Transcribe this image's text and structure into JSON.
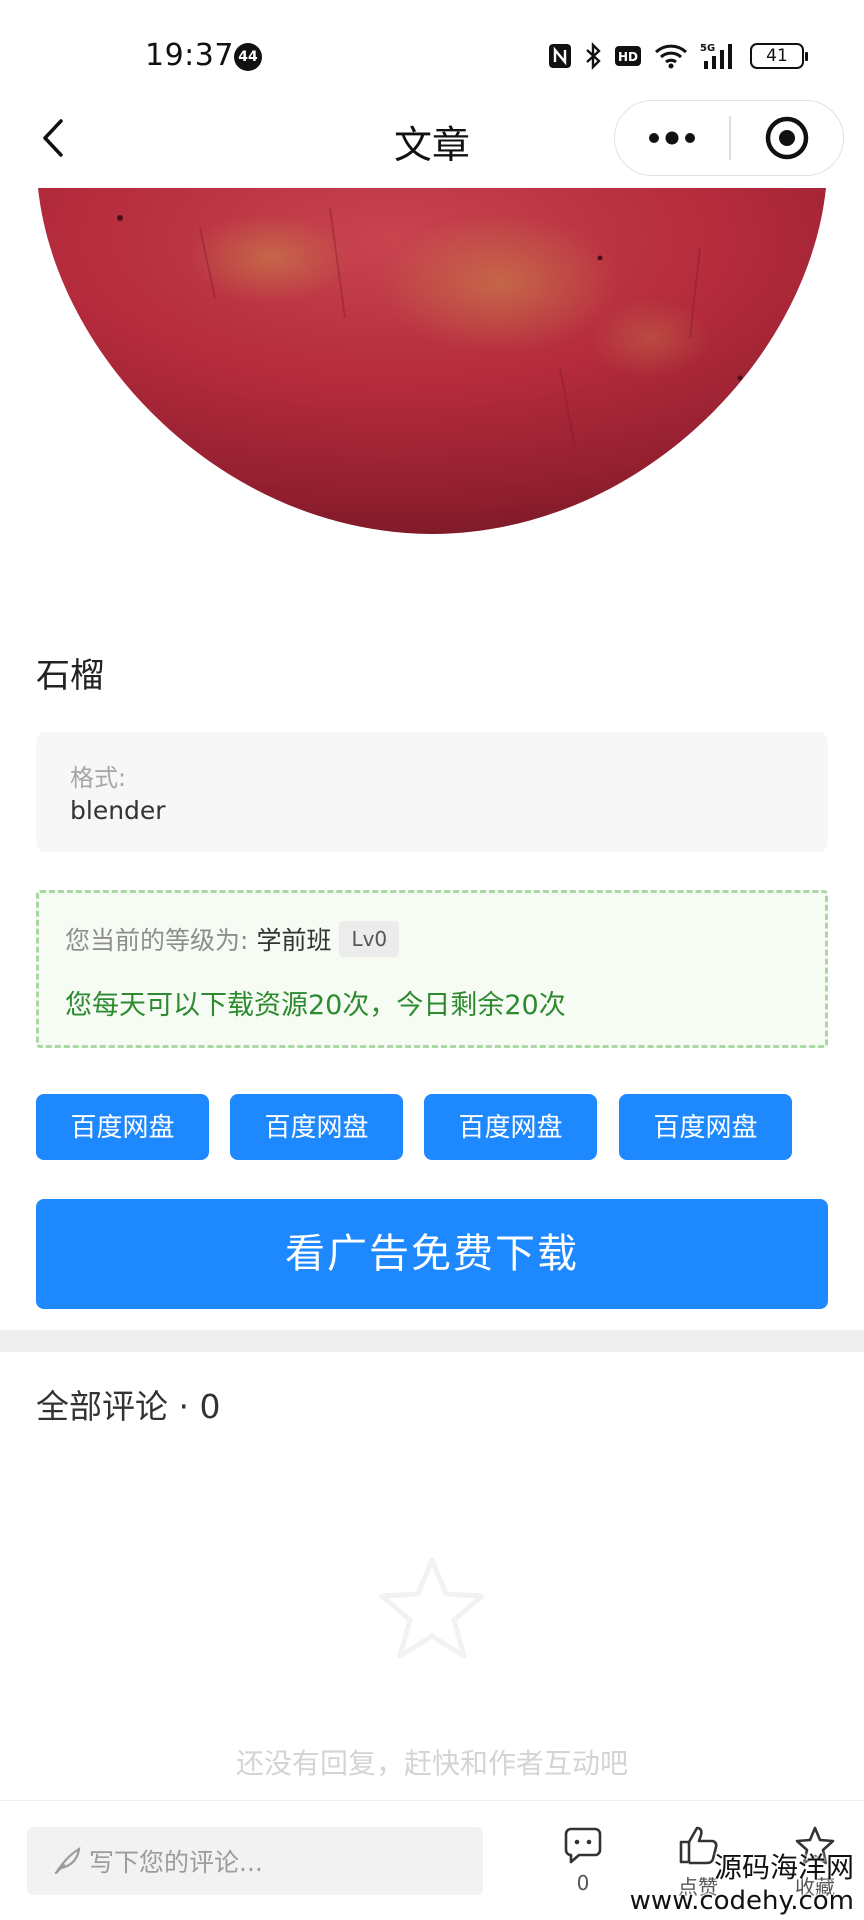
{
  "status_bar": {
    "time": "19:37",
    "notification_count": "44",
    "battery": "41",
    "icons": [
      "nfc-icon",
      "bluetooth-icon",
      "hd-icon",
      "wifi-icon",
      "5g-signal-icon",
      "battery-icon"
    ]
  },
  "nav": {
    "title": "文章",
    "back_icon": "chevron-left-icon",
    "more_icon": "more-dots-icon",
    "close_icon": "target-circle-icon"
  },
  "article": {
    "title": "石榴",
    "format_label": "格式:",
    "format_value": "blender"
  },
  "level": {
    "prefix": "您当前的等级为:",
    "name": "学前班",
    "badge": "Lv0",
    "quota": "您每天可以下载资源20次，今日剩余20次",
    "border_color": "#a9d8a2",
    "text_color": "#2e8a2e"
  },
  "download_buttons": [
    "百度网盘",
    "百度网盘",
    "百度网盘",
    "百度网盘"
  ],
  "ad_button": "看广告免费下载",
  "accent_color": "#1e88ff",
  "comments": {
    "header": "全部评论 · 0",
    "empty_text": "还没有回复，赶快和作者互动吧",
    "empty_icon": "star-outline-icon"
  },
  "bottom_bar": {
    "placeholder": "写下您的评论...",
    "comment_count": "0",
    "like_label": "点赞",
    "favorite_label": "收藏"
  },
  "watermark": {
    "line1": "源码海洋网",
    "line2": "www.codehy.com"
  }
}
